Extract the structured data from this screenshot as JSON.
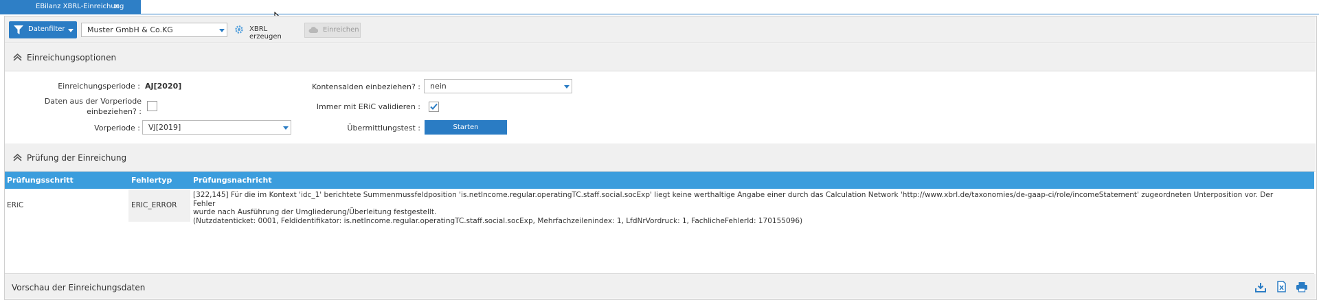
{
  "tab": {
    "title": "EBilanz XBRL-Einreichung",
    "close": "✕"
  },
  "toolbar": {
    "filter_label": "Datenfilter",
    "company_value": "Muster GmbH & Co.KG",
    "xbrl_label": "XBRL erzeugen",
    "submit_label": "Einreichen"
  },
  "options": {
    "title": "Einreichungsoptionen",
    "period_label": "Einreichungsperiode :",
    "period_value": "AJ[2020]",
    "prev_data_label_1": "Daten aus der Vorperiode",
    "prev_data_label_2": "einbeziehen? :",
    "prev_data_checked": false,
    "prev_period_label": "Vorperiode :",
    "prev_period_value": "VJ[2019]",
    "balances_label": "Kontensalden einbeziehen? :",
    "balances_value": "nein",
    "eric_label": "Immer mit ERiC validieren :",
    "eric_checked": true,
    "test_label": "Übermittlungstest :",
    "start_label": "Starten"
  },
  "check": {
    "title": "Prüfung der Einreichung",
    "columns": [
      "Prüfungsschritt",
      "Fehlertyp",
      "Prüfungsnachricht"
    ],
    "rows": [
      {
        "step": "ERiC",
        "type": "ERIC_ERROR",
        "message_1": "[322,145] Für die im Kontext 'idc_1' berichtete Summenmussfeldposition 'is.netIncome.regular.operatingTC.staff.social.socExp' liegt keine werthaltige Angabe einer durch das Calculation Network 'http://www.xbrl.de/taxonomies/de-gaap-ci/role/incomeStatement' zugeordneten Unterposition vor. Der Fehler",
        "message_2": "wurde nach Ausführung der Umgliederung/Überleitung festgestellt.",
        "message_3": "(Nutzdatenticket: 0001, Feldidentifikator: is.netIncome.regular.operatingTC.staff.social.socExp, Mehrfachzeilenindex: 1, LfdNrVordruck: 1, FachlicheFehlerId: 170155096)"
      }
    ]
  },
  "preview": {
    "title": "Vorschau der Einreichungsdaten"
  },
  "colors": {
    "accent": "#2a7cc4",
    "grid_header": "#3b9ddd",
    "toolbar_bg": "#f0f0f0"
  },
  "icons": [
    "filter-icon",
    "gear-icon",
    "cloud-upload-icon",
    "collapse-arrow-icon",
    "download-icon",
    "excel-icon",
    "print-icon",
    "mouse-cursor-icon"
  ]
}
